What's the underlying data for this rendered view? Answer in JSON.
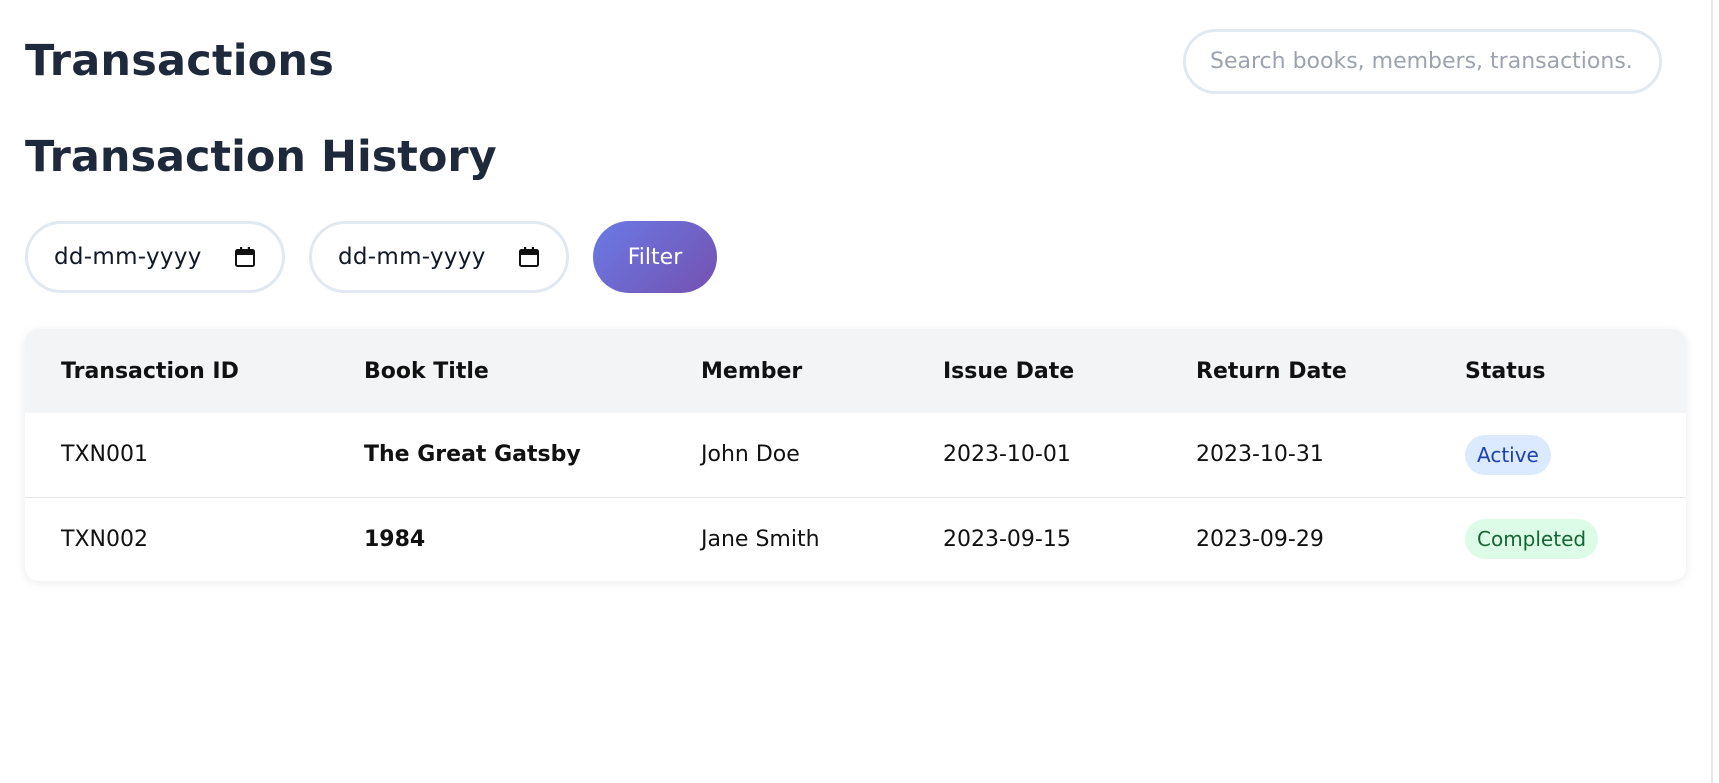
{
  "header": {
    "title": "Transactions",
    "search": {
      "placeholder": "Search books, members, transactions...",
      "value": ""
    }
  },
  "section": {
    "title": "Transaction History"
  },
  "filters": {
    "start_date": {
      "placeholder": "dd-mm-yyyy",
      "icon": "calendar-icon"
    },
    "end_date": {
      "placeholder": "dd-mm-yyyy",
      "icon": "calendar-icon"
    },
    "filter_label": "Filter",
    "filter_gradient": [
      "#6a7ae6",
      "#7451b0"
    ]
  },
  "table": {
    "columns": [
      "Transaction ID",
      "Book Title",
      "Member",
      "Issue Date",
      "Return Date",
      "Status"
    ],
    "rows": [
      {
        "id": "TXN001",
        "book": "The Great Gatsby",
        "member": "John Doe",
        "issue": "2023-10-01",
        "return": "2023-10-31",
        "status": "Active",
        "status_color": "#1e40af",
        "status_bg": "#dbeafe"
      },
      {
        "id": "TXN002",
        "book": "1984",
        "member": "Jane Smith",
        "issue": "2023-09-15",
        "return": "2023-09-29",
        "status": "Completed",
        "status_color": "#166534",
        "status_bg": "#dcfce7"
      }
    ]
  }
}
